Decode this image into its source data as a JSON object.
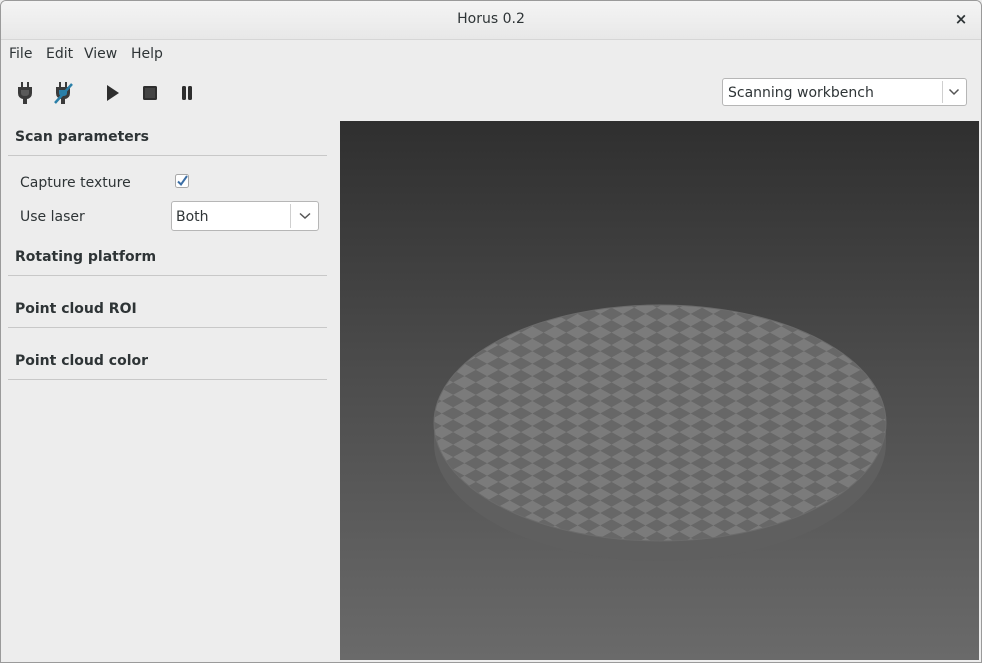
{
  "window": {
    "title": "Horus 0.2",
    "close_label": "×"
  },
  "menu": [
    {
      "label": "File"
    },
    {
      "label": "Edit"
    },
    {
      "label": "View"
    },
    {
      "label": "Help"
    }
  ],
  "toolbar": {
    "workbench_select": {
      "value": "Scanning workbench"
    }
  },
  "sidebar": {
    "scan_parameters": {
      "title": "Scan parameters",
      "capture_texture": {
        "label": "Capture texture",
        "checked": true
      },
      "use_laser": {
        "label": "Use laser",
        "value": "Both"
      }
    },
    "rotating_platform": {
      "title": "Rotating platform"
    },
    "point_cloud_roi": {
      "title": "Point cloud ROI"
    },
    "point_cloud_color": {
      "title": "Point cloud color"
    }
  },
  "colors": {
    "checkbox_check": "#3b6ea5",
    "viewport_top": "#2f2f2f",
    "viewport_bottom": "#6a6a6a",
    "platform_light": "#7a7a7a",
    "platform_dark": "#646464"
  }
}
